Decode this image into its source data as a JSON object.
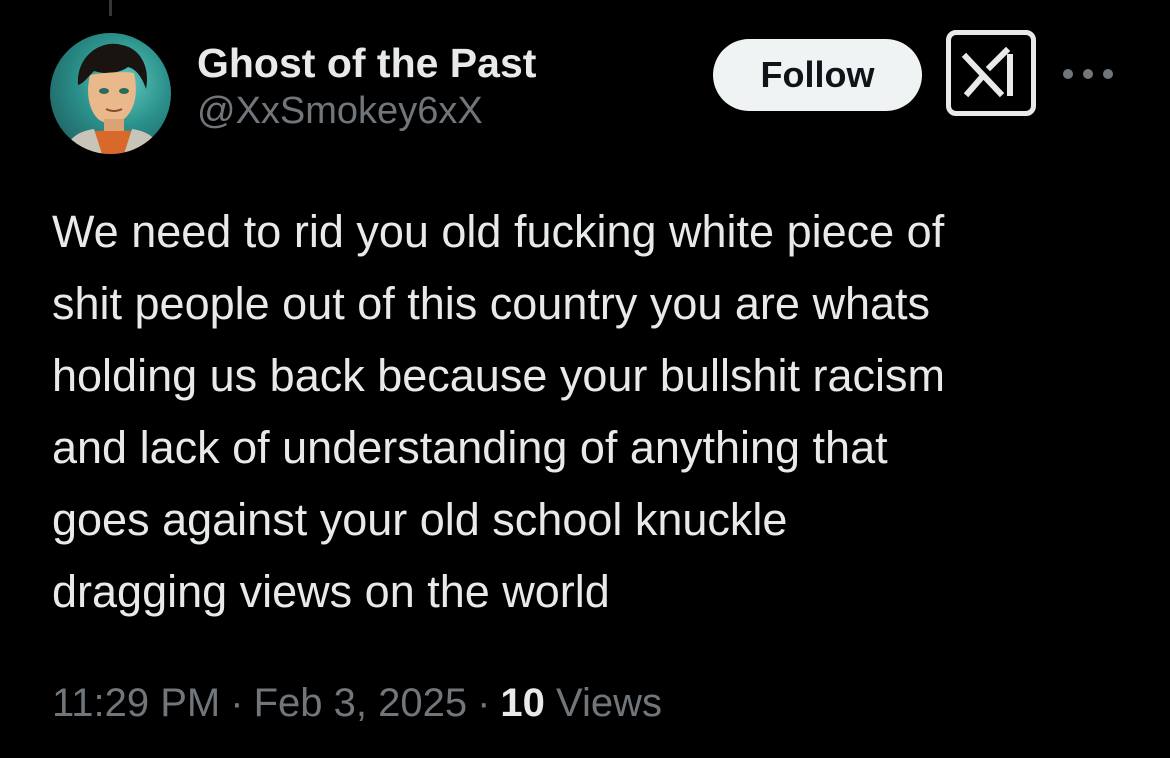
{
  "author": {
    "display_name": "Ghost of the Past",
    "handle": "@XxSmokey6xX"
  },
  "actions": {
    "follow_label": "Follow",
    "grok_icon": "grok-icon",
    "more_icon": "more-options-icon"
  },
  "tweet": {
    "text": "We need to rid you old fucking white piece of\nshit people out of this country you are whats\nholding us back because your bullshit racism\nand lack of understanding of anything that\ngoes against your old school knuckle\ndragging views on the world"
  },
  "meta": {
    "time": "11:29 PM",
    "date": "Feb 3, 2025",
    "views_count": "10",
    "views_label": "Views",
    "separator": "·"
  },
  "colors": {
    "background": "#000000",
    "primary_text": "#e7e9ea",
    "secondary_text": "#71767b",
    "follow_bg": "#eff3f4"
  }
}
